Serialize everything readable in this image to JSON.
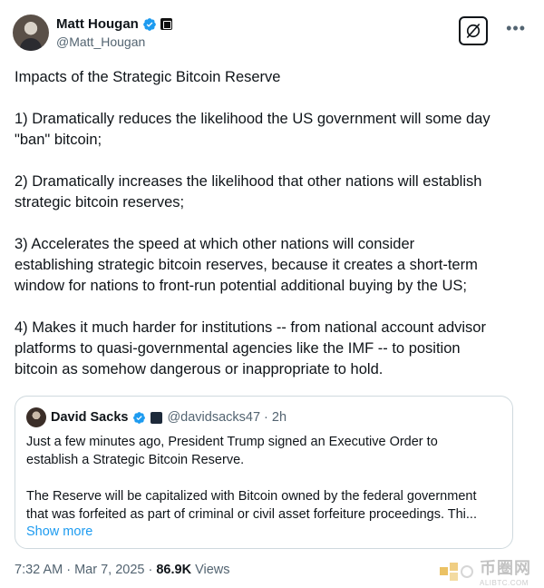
{
  "author": {
    "display_name": "Matt Hougan",
    "handle": "@Matt_Hougan"
  },
  "tweet": {
    "paragraphs": [
      "Impacts of the Strategic Bitcoin Reserve",
      "1) Dramatically reduces the likelihood the US government will some day\n\"ban\" bitcoin;",
      "2) Dramatically increases the likelihood that other nations will establish\nstrategic bitcoin reserves;",
      "3) Accelerates the speed at which other nations will consider\nestablishing strategic bitcoin reserves, because it creates a short-term\nwindow for nations to front-run potential additional buying by the US;",
      "4) Makes it much harder for institutions -- from national account advisor\nplatforms to quasi-governmental agencies like the IMF -- to position\nbitcoin as somehow dangerous or inappropriate to hold."
    ]
  },
  "quote": {
    "display_name": "David Sacks",
    "handle_time": "@davidsacks47 · 2h",
    "paragraphs": [
      "Just a few minutes ago, President Trump signed an Executive Order to\nestablish a Strategic Bitcoin Reserve.",
      "The Reserve will be capitalized with Bitcoin owned by the federal government\nthat was forfeited as part of criminal or civil asset forfeiture proceedings. Thi..."
    ],
    "show_more": "Show more"
  },
  "footer": {
    "timestamp": "7:32 AM · Mar 7, 2025 · ",
    "views_count": "86.9K",
    "views_label": " Views"
  },
  "watermark": {
    "main": "币圈网",
    "sub": "ALIBTC.COM"
  },
  "colors": {
    "verified": "#1d9bf0",
    "link": "#1d9bf0",
    "secondary_text": "#536471",
    "border": "#cfd9de"
  },
  "icons": [
    "verified-badge-icon",
    "affiliate-badge-icon",
    "grok-icon",
    "more-options-icon"
  ]
}
